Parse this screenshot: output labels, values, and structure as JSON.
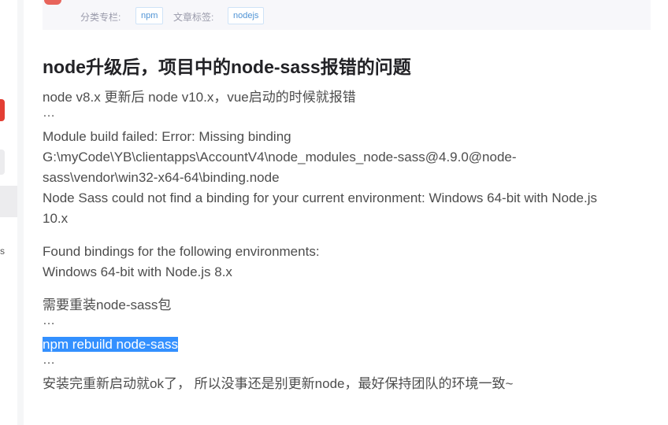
{
  "sidebar": {
    "partial_text": "s"
  },
  "tags": {
    "category_label": "分类专栏:",
    "category_value": "npm",
    "tag_label": "文章标签:",
    "tag_value": "nodejs"
  },
  "article": {
    "title": "node升级后，项目中的node-sass报错的问题",
    "lines": {
      "l1": "node v8.x 更新后 node v10.x，vue启动的时候就报错",
      "e1": "…",
      "l2": "Module build failed: Error: Missing binding",
      "l3": "G:\\myCode\\YB\\clientapps\\AccountV4\\node_modules_node-sass@4.9.0@node-",
      "l4": "sass\\vendor\\win32-x64-64\\binding.node",
      "l5": "Node Sass could not find a binding for your current environment: Windows 64-bit with Node.js",
      "l6": "10.x",
      "l7": "Found bindings for the following environments:",
      "l8": "Windows 64-bit with Node.js 8.x",
      "l9": "需要重装node-sass包",
      "e2": "…",
      "cmd": "npm rebuild node-sass",
      "e3": "…",
      "l10": "安装完重新启动就ok了， 所以没事还是别更新node，最好保持团队的环境一致~"
    }
  },
  "colors": {
    "highlight": "#3390ff",
    "accent_red": "#e33e33",
    "tag_blue": "#5094d5"
  }
}
